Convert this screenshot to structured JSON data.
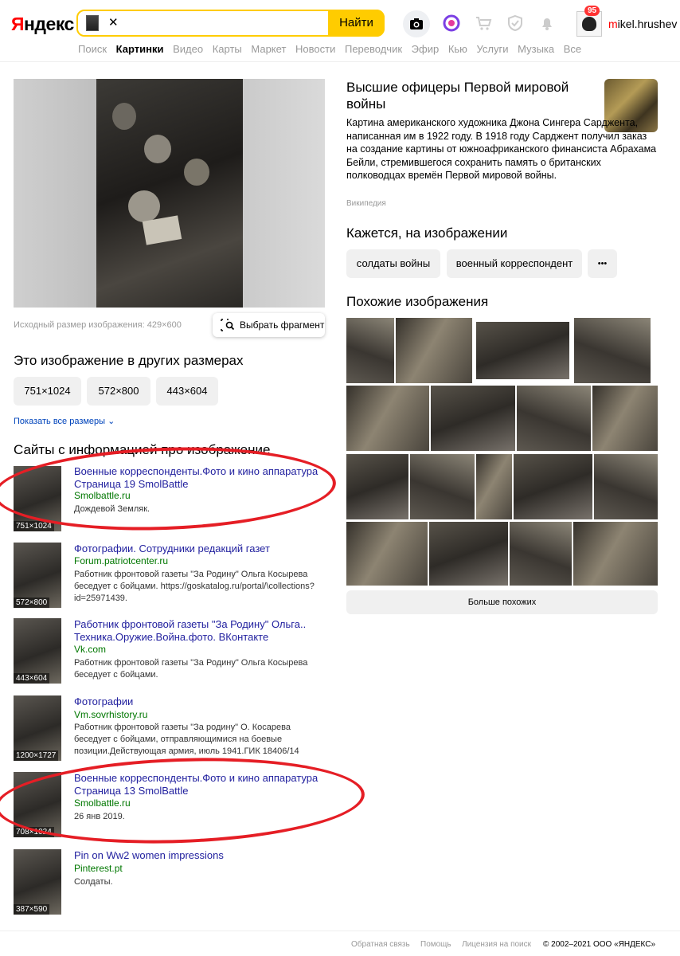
{
  "header": {
    "logo": "Яндекс",
    "search_button": "Найти",
    "username_first": "m",
    "username_rest": "ikel.hrushev",
    "badge": "95",
    "tabs": [
      "Поиск",
      "Картинки",
      "Видео",
      "Карты",
      "Маркет",
      "Новости",
      "Переводчик",
      "Эфир",
      "Кью",
      "Услуги",
      "Музыка",
      "Все"
    ],
    "active_tab": "Картинки"
  },
  "image": {
    "original_size": "Исходный размер изображения: 429×600",
    "fragment_button": "Выбрать фрагмент"
  },
  "sizes": {
    "heading": "Это изображение в других размерах",
    "items": [
      "751×1024",
      "572×800",
      "443×604"
    ],
    "show_all": "Показать все размеры"
  },
  "sites": {
    "heading": "Сайты с информацией про изображение",
    "items": [
      {
        "title": "Военные корреспонденты.Фото и кино аппаратура Страница 19 SmolBattle",
        "url": "Smolbattle.ru",
        "desc": "Дождевой Земляк.",
        "size": "751×1024"
      },
      {
        "title": "Фотографии. Сотрудники редакций газет",
        "url": "Forum.patriotcenter.ru",
        "desc": "Работник фронтовой газеты \"За Родину\" Ольга Косырева беседует с бойцами. https://goskatalog.ru/portal/\\collections?id=25971439.",
        "size": "572×800"
      },
      {
        "title": "Работник фронтовой газеты \"За Родину\" Ольга.. Техника.Оружие.Война.фото. ВКонтакте",
        "url": "Vk.com",
        "desc": "Работник фронтовой газеты \"За Родину\" Ольга Косырева беседует с бойцами.",
        "size": "443×604"
      },
      {
        "title": "Фотографии",
        "url": "Vm.sovrhistory.ru",
        "desc": "Работник фронтовой газеты \"За родину\" О. Косарева беседует с бойцами, отправляющимися на боевые позиции.Действующая армия, июль 1941.ГИК 18406/14",
        "size": "1200×1727"
      },
      {
        "title": "Военные корреспонденты.Фото и кино аппаратура Страница 13 SmolBattle",
        "url": "Smolbattle.ru",
        "desc": "26 янв 2019.",
        "size": "708×1024"
      },
      {
        "title": "Pin on Ww2 women impressions",
        "url": "Pinterest.pt",
        "desc": "Солдаты.",
        "size": "387×590"
      }
    ]
  },
  "entity": {
    "title": "Высшие офицеры Первой мировой войны",
    "desc": "Картина американского художника Джона Сингера Сарджента, написанная им в 1922 году. В 1918 году Сарджент получил заказ на создание картины от южноафриканского финансиста Абрахама Бейли, стремившегося сохранить память о британских полководцах времён Первой мировой войны.",
    "source": "Википедия"
  },
  "tags": {
    "heading": "Кажется, на изображении",
    "items": [
      "солдаты войны",
      "военный корреспондент"
    ],
    "more": "•••"
  },
  "similar": {
    "heading": "Похожие изображения",
    "more_button": "Больше похожих"
  },
  "footer": {
    "feedback": "Обратная связь",
    "help": "Помощь",
    "license": "Лицензия на поиск",
    "copyright": "© 2002–2021 ООО «ЯНДЕКС»"
  }
}
